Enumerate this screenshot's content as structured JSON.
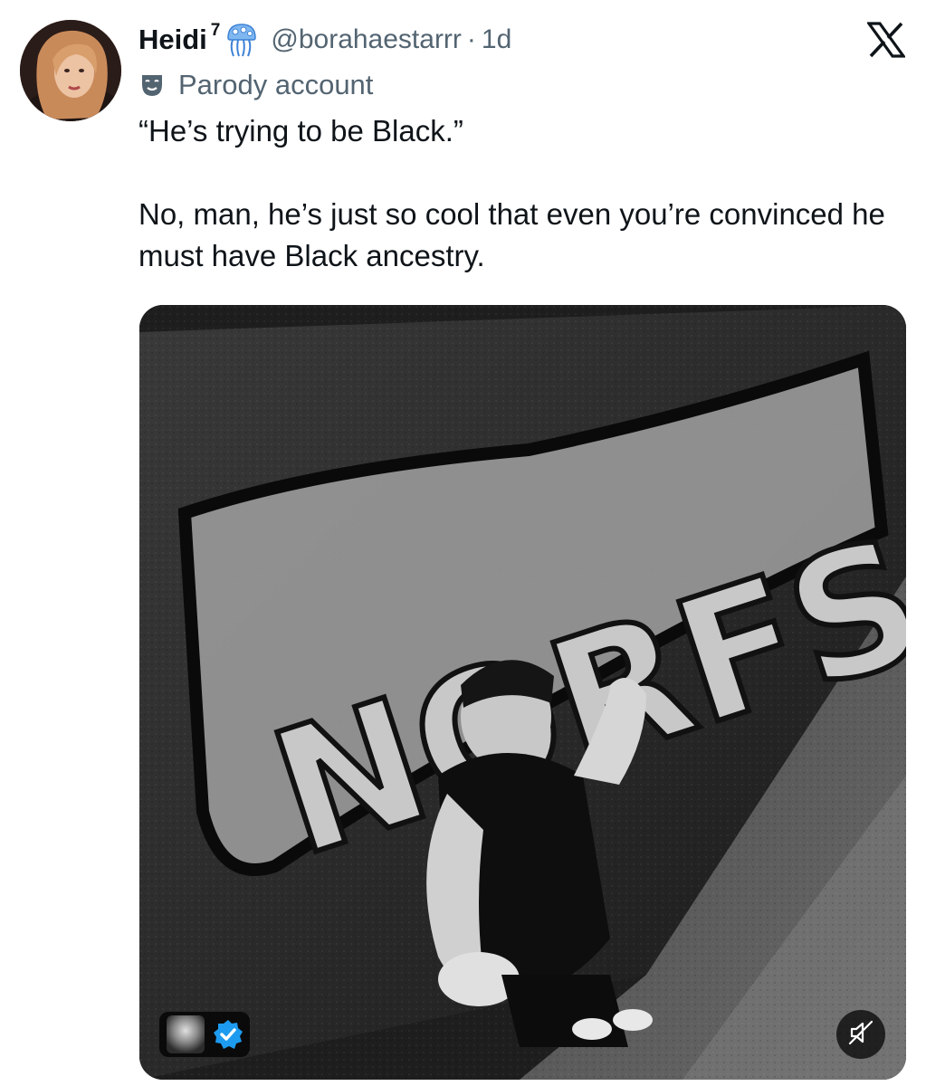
{
  "tweet": {
    "author": {
      "display_name": "Heidi",
      "name_superscript": "7",
      "name_emoji": "jellyfish-emoji",
      "handle": "@borahaestarrr",
      "separator": "·",
      "timestamp": "1d",
      "account_label": "Parody account",
      "account_label_icon": "theater-mask-icon"
    },
    "text_lines": [
      "“He’s trying to be Black.”",
      "No, man, he’s just so cool that even you’re convinced he must have Black ancestry."
    ],
    "media": {
      "type": "video",
      "graffiti_text": "NORFSIDE",
      "badge_icons": [
        "account-avatar-icon",
        "verified-badge-icon"
      ],
      "mute_icon": "muted-speaker-icon",
      "accent_color": "#1d9bf0"
    }
  },
  "platform": {
    "logo": "x-logo-icon"
  }
}
